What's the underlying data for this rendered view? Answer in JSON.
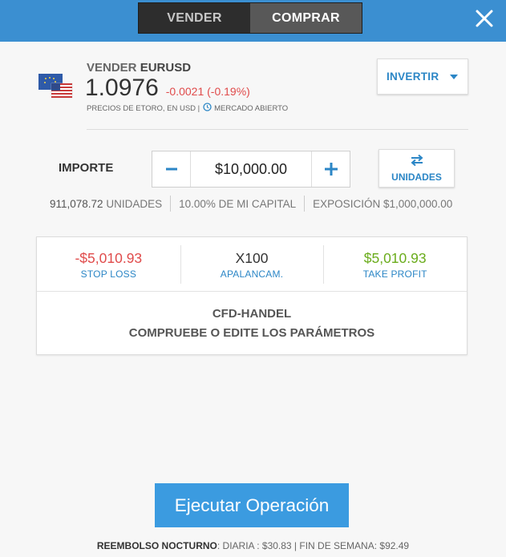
{
  "topbar": {
    "sell_label": "VENDER",
    "buy_label": "COMPRAR",
    "close_icon": "close-icon",
    "accent": "#3b8fd1"
  },
  "instrument": {
    "action": "VENDER",
    "symbol": "EURUSD",
    "price": "1.0976",
    "change": "-0.0021 (-0.19%)",
    "source_text": "PRECIOS DE ETORO, EN USD |",
    "market_status": "MERCADO ABIERTO",
    "flag_icon": "eu-us-flags-icon"
  },
  "invert": {
    "label": "INVERTIR"
  },
  "amount": {
    "label": "IMPORTE",
    "value": "$10,000.00",
    "units_button": "UNIDADES"
  },
  "stats": {
    "units_value": "911,078.72",
    "units_label": "UNIDADES",
    "capital": "10.00% DE MI CAPITAL",
    "exposure": "EXPOSICIÓN $1,000,000.00"
  },
  "params": {
    "stop_loss_value": "-$5,010.93",
    "stop_loss_label": "STOP LOSS",
    "leverage_value": "X100",
    "leverage_label": "APALANCAM.",
    "take_profit_value": "$5,010.93",
    "take_profit_label": "TAKE PROFIT",
    "note_line1": "CFD-HANDEL",
    "note_line2": "COMPRUEBE O EDITE LOS PARÁMETROS"
  },
  "execute": {
    "label": "Ejecutar Operación"
  },
  "footer": {
    "title": "REEMBOLSO NOCTURNO",
    "details": ": DIARIA : $30.83 | FIN DE SEMANA: $92.49"
  },
  "colors": {
    "negative": "#e04b4b",
    "positive": "#6aac1b",
    "link_blue": "#2b86c6",
    "execute_blue": "#3b9be0"
  }
}
